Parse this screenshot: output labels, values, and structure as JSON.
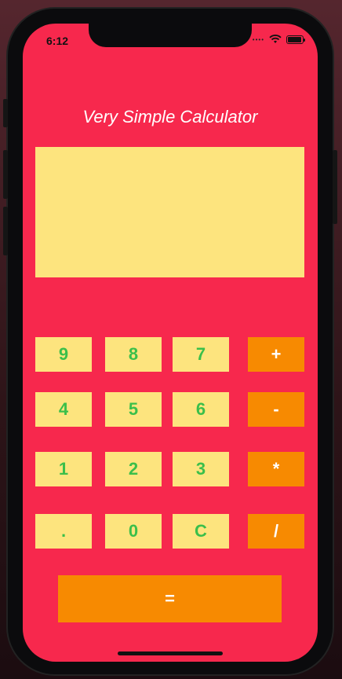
{
  "status": {
    "time": "6:12"
  },
  "app": {
    "title": "Very Simple Calculator",
    "display_value": ""
  },
  "keys": {
    "row1": [
      "9",
      "8",
      "7",
      "+"
    ],
    "row2": [
      "4",
      "5",
      "6",
      "-"
    ],
    "row3": [
      "1",
      "2",
      "3",
      "*"
    ],
    "row4": [
      ".",
      "0",
      "C",
      "/"
    ],
    "equals": "="
  },
  "colors": {
    "background": "#f7284d",
    "display": "#fde47e",
    "digit_text": "#3bbf4a",
    "operator": "#f78a01"
  },
  "icons": [
    "wifi-icon",
    "battery-icon",
    "cellular-dots-icon"
  ]
}
